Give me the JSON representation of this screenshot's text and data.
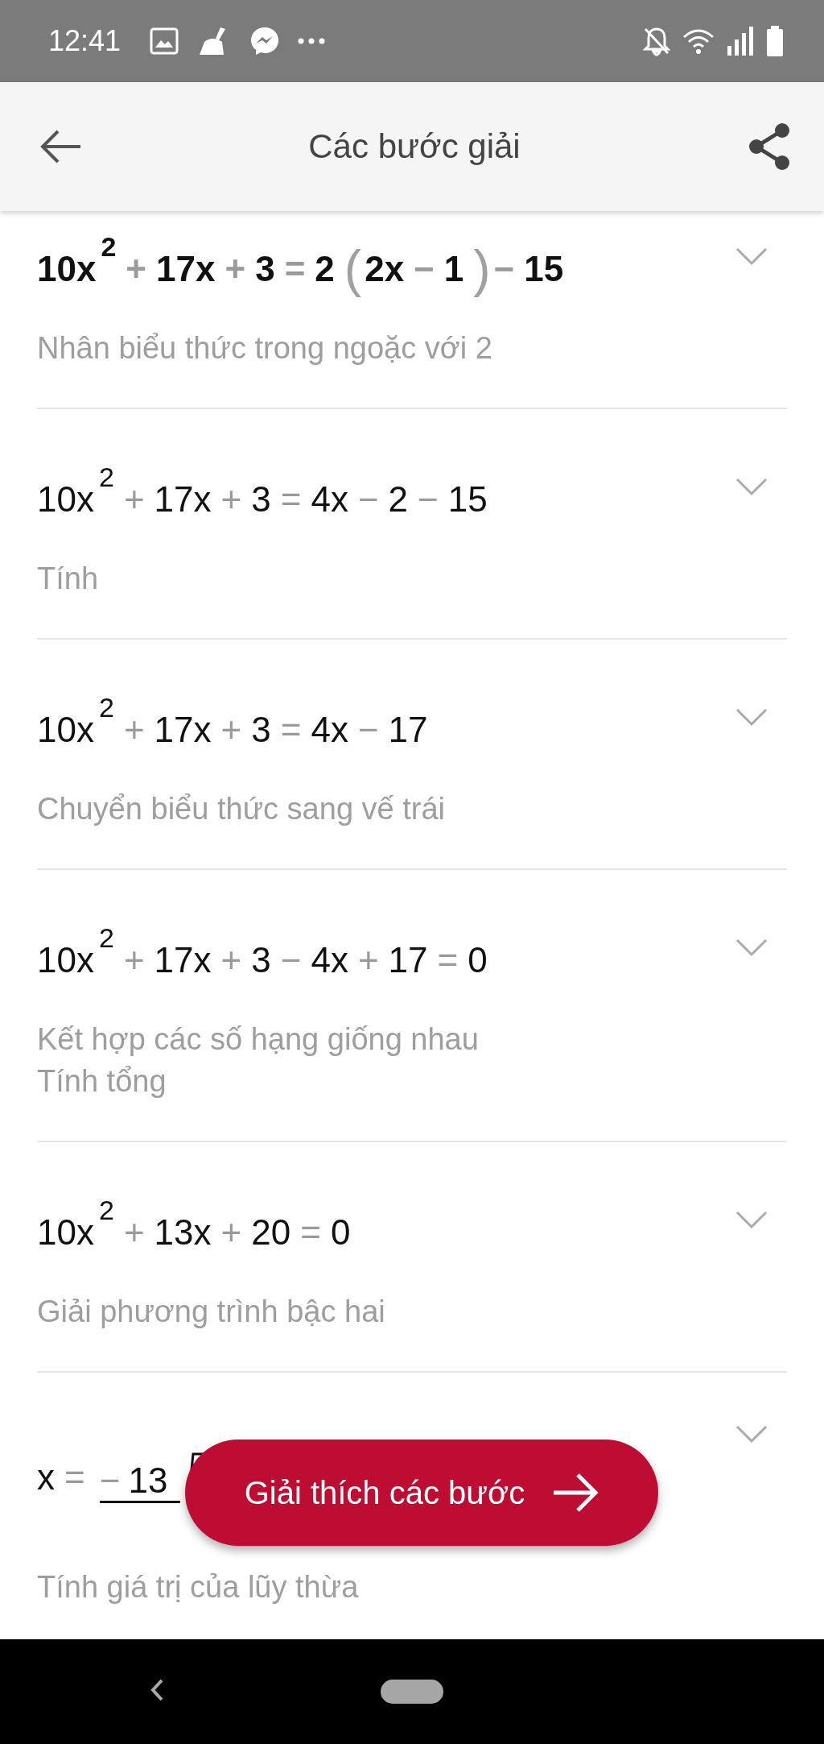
{
  "status_bar": {
    "time": "12:41"
  },
  "app_bar": {
    "title": "Các bước giải"
  },
  "steps": [
    {
      "highlighted": true,
      "formula": [
        {
          "kind": "term",
          "t": "10x"
        },
        {
          "kind": "sup",
          "t": "2"
        },
        {
          "kind": "op",
          "t": "+"
        },
        {
          "kind": "term",
          "t": "17x"
        },
        {
          "kind": "op",
          "t": "+"
        },
        {
          "kind": "term",
          "t": "3"
        },
        {
          "kind": "op",
          "t": "="
        },
        {
          "kind": "term",
          "t": "2"
        },
        {
          "kind": "paren",
          "t": "("
        },
        {
          "kind": "term",
          "t": "2x"
        },
        {
          "kind": "op",
          "t": "−"
        },
        {
          "kind": "term",
          "t": "1"
        },
        {
          "kind": "paren",
          "t": ")"
        },
        {
          "kind": "op",
          "t": "−"
        },
        {
          "kind": "term",
          "t": "15"
        }
      ],
      "description": [
        "Nhân biểu thức trong ngoặc với 2"
      ]
    },
    {
      "highlighted": false,
      "formula": [
        {
          "kind": "term",
          "t": "10x"
        },
        {
          "kind": "sup",
          "t": "2"
        },
        {
          "kind": "op",
          "t": "+"
        },
        {
          "kind": "term",
          "t": "17x"
        },
        {
          "kind": "op",
          "t": "+"
        },
        {
          "kind": "term",
          "t": "3"
        },
        {
          "kind": "op",
          "t": "="
        },
        {
          "kind": "term",
          "t": "4x"
        },
        {
          "kind": "op",
          "t": "−"
        },
        {
          "kind": "term",
          "t": "2"
        },
        {
          "kind": "op",
          "t": "−"
        },
        {
          "kind": "term",
          "t": "15"
        }
      ],
      "description": [
        "Tính"
      ]
    },
    {
      "highlighted": false,
      "formula": [
        {
          "kind": "term",
          "t": "10x"
        },
        {
          "kind": "sup",
          "t": "2"
        },
        {
          "kind": "op",
          "t": "+"
        },
        {
          "kind": "term",
          "t": "17x"
        },
        {
          "kind": "op",
          "t": "+"
        },
        {
          "kind": "term",
          "t": "3"
        },
        {
          "kind": "op",
          "t": "="
        },
        {
          "kind": "term",
          "t": "4x"
        },
        {
          "kind": "op",
          "t": "−"
        },
        {
          "kind": "term",
          "t": "17"
        }
      ],
      "description": [
        "Chuyển biểu thức sang vế trái"
      ]
    },
    {
      "highlighted": false,
      "formula": [
        {
          "kind": "term",
          "t": "10x"
        },
        {
          "kind": "sup",
          "t": "2"
        },
        {
          "kind": "op",
          "t": "+"
        },
        {
          "kind": "term",
          "t": "17x"
        },
        {
          "kind": "op",
          "t": "+"
        },
        {
          "kind": "term",
          "t": "3"
        },
        {
          "kind": "op",
          "t": "−"
        },
        {
          "kind": "term",
          "t": "4x"
        },
        {
          "kind": "op",
          "t": "+"
        },
        {
          "kind": "term",
          "t": "17"
        },
        {
          "kind": "op",
          "t": "="
        },
        {
          "kind": "term",
          "t": "0"
        }
      ],
      "description": [
        "Kết hợp các số hạng giống nhau",
        "Tính tổng"
      ]
    },
    {
      "highlighted": false,
      "formula": [
        {
          "kind": "term",
          "t": "10x"
        },
        {
          "kind": "sup",
          "t": "2"
        },
        {
          "kind": "op",
          "t": "+"
        },
        {
          "kind": "term",
          "t": "13x"
        },
        {
          "kind": "op",
          "t": "+"
        },
        {
          "kind": "term",
          "t": "20"
        },
        {
          "kind": "op",
          "t": "="
        },
        {
          "kind": "term",
          "t": "0"
        }
      ],
      "description": [
        "Giải phương trình bậc hai"
      ]
    },
    {
      "highlighted": false,
      "formula": [
        {
          "kind": "term",
          "t": "x"
        },
        {
          "kind": "op",
          "t": "="
        },
        {
          "kind": "fraction",
          "sign": "−",
          "numerator": "13"
        }
      ],
      "description": [
        "Tính giá trị của lũy thừa"
      ]
    }
  ],
  "action_button": {
    "label": "Giải thích các bước"
  }
}
